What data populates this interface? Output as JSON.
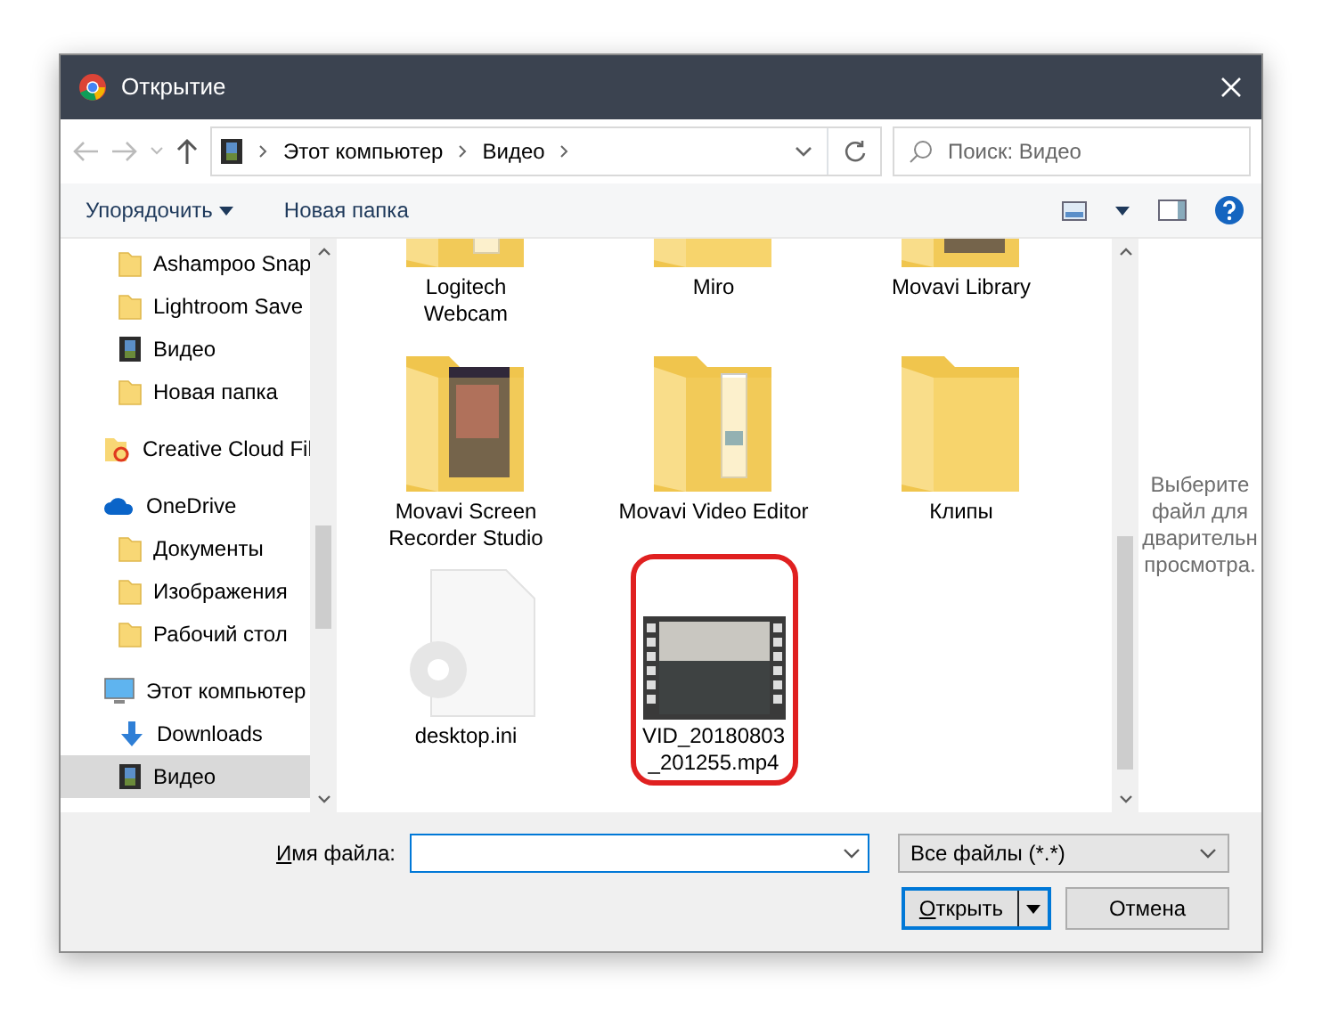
{
  "window": {
    "title": "Открытие"
  },
  "address": {
    "crumbs": [
      "Этот компьютер",
      "Видео"
    ],
    "search_placeholder": "Поиск: Видео"
  },
  "toolbar": {
    "organize": "Упорядочить",
    "new_folder": "Новая папка"
  },
  "sidebar": {
    "continued_items": [
      {
        "kind": "folder",
        "label": "Ashampoo Snap",
        "selected": false
      },
      {
        "kind": "folder",
        "label": "Lightroom Save",
        "selected": false
      },
      {
        "kind": "video",
        "label": "Видео",
        "selected": false
      },
      {
        "kind": "folder",
        "label": "Новая папка",
        "selected": false
      }
    ],
    "items": [
      {
        "kind": "cloud-folder",
        "label": "Creative Cloud Fil",
        "selected": false
      },
      {
        "kind": "onedrive",
        "label": "OneDrive",
        "selected": false,
        "children": [
          {
            "kind": "folder",
            "label": "Документы",
            "selected": false
          },
          {
            "kind": "folder",
            "label": "Изображения",
            "selected": false
          },
          {
            "kind": "folder",
            "label": "Рабочий стол",
            "selected": false
          }
        ]
      },
      {
        "kind": "computer",
        "label": "Этот компьютер",
        "selected": false,
        "children": [
          {
            "kind": "downloads",
            "label": "Downloads",
            "selected": false
          },
          {
            "kind": "video",
            "label": "Видео",
            "selected": true
          }
        ]
      }
    ]
  },
  "files": [
    {
      "kind": "folder-docs",
      "label": "Logitech Webcam",
      "highlighted": false
    },
    {
      "kind": "folder",
      "label": "Miro",
      "highlighted": false
    },
    {
      "kind": "folder-picture",
      "label": "Movavi Library",
      "highlighted": false
    },
    {
      "kind": "folder-picture",
      "label": "Movavi Screen Recorder Studio",
      "highlighted": false
    },
    {
      "kind": "folder-docs",
      "label": "Movavi Video Editor",
      "highlighted": false
    },
    {
      "kind": "folder",
      "label": "Клипы",
      "highlighted": false
    },
    {
      "kind": "settings-file",
      "label": "desktop.ini",
      "highlighted": false
    },
    {
      "kind": "video",
      "label": "VID_20180803_201255.mp4",
      "highlighted": true
    }
  ],
  "preview": {
    "lines": [
      "Выберите",
      "файл для",
      "дварительн",
      "просмотра."
    ]
  },
  "footer": {
    "filename_label": "Имя файла:",
    "filter": "Все файлы (*.*)",
    "open": "Открыть",
    "cancel": "Отмена"
  }
}
